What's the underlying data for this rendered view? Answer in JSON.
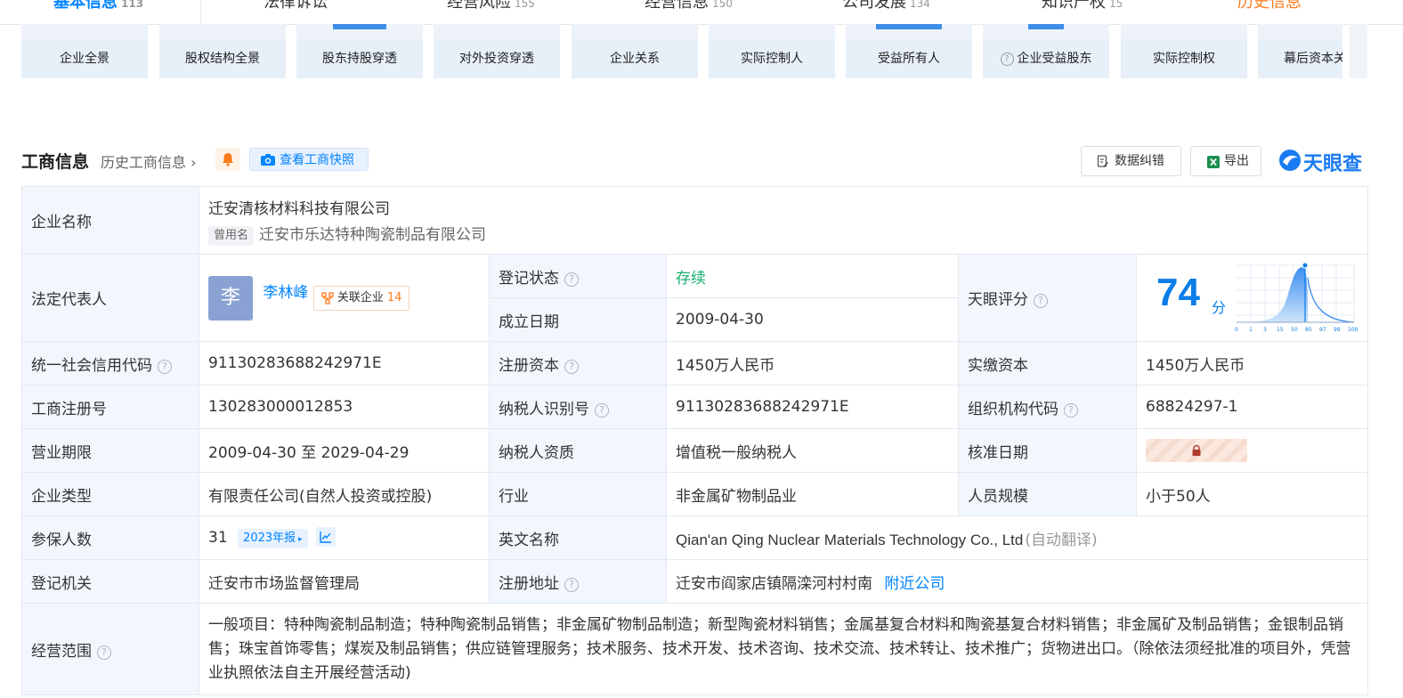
{
  "nav": [
    {
      "label": "基本信息",
      "count": "113",
      "active": true
    },
    {
      "label": "法律诉讼",
      "count": ""
    },
    {
      "label": "经营风险",
      "count": "155"
    },
    {
      "label": "经营信息",
      "count": "150"
    },
    {
      "label": "公司发展",
      "count": "134"
    },
    {
      "label": "知识产权",
      "count": "15"
    },
    {
      "label": "历史信息",
      "count": ""
    }
  ],
  "cards": [
    {
      "label": "企业全景"
    },
    {
      "label": "股权结构全景"
    },
    {
      "label": "股东持股穿透"
    },
    {
      "label": "对外投资穿透"
    },
    {
      "label": "企业关系"
    },
    {
      "label": "实际控制人"
    },
    {
      "label": "受益所有人"
    },
    {
      "label": "企业受益股东"
    },
    {
      "label": "实际控制权"
    },
    {
      "label": "幕后资本关联"
    }
  ],
  "section": {
    "title": "工商信息",
    "history_link": "历史工商信息",
    "snapshot_btn": "查看工商快照",
    "correct_btn": "数据纠错",
    "export_btn": "导出",
    "logo_text": "天眼查"
  },
  "company": {
    "name_label": "企业名称",
    "name": "迁安清核材料科技有限公司",
    "used_name_tag": "曾用名",
    "used_name": "迁安市乐达特种陶瓷制品有限公司",
    "legal_rep_label": "法定代表人",
    "avatar_char": "李",
    "legal_rep": "李林峰",
    "related_label": "关联企业",
    "related_count": "14",
    "reg_status_label": "登记状态",
    "reg_status": "存续",
    "est_date_label": "成立日期",
    "est_date": "2009-04-30",
    "score_label": "天眼评分",
    "score": "74",
    "score_unit": "分",
    "score_ticks": [
      "0",
      "1",
      "3",
      "15",
      "50",
      "85",
      "97",
      "99",
      "100"
    ],
    "credit_code_label": "统一社会信用代码",
    "credit_code": "91130283688242971E",
    "reg_capital_label": "注册资本",
    "reg_capital": "1450万人民币",
    "paid_capital_label": "实缴资本",
    "paid_capital": "1450万人民币",
    "reg_no_label": "工商注册号",
    "reg_no": "130283000012853",
    "taxpayer_id_label": "纳税人识别号",
    "taxpayer_id": "91130283688242971E",
    "org_code_label": "组织机构代码",
    "org_code": "68824297-1",
    "term_label": "营业期限",
    "term": "2009-04-30 至 2029-04-29",
    "taxpayer_qual_label": "纳税人资质",
    "taxpayer_qual": "增值税一般纳税人",
    "approve_date_label": "核准日期",
    "type_label": "企业类型",
    "type": "有限责任公司(自然人投资或控股)",
    "industry_label": "行业",
    "industry": "非金属矿物制品业",
    "staff_label": "人员规模",
    "staff": "小于50人",
    "insured_label": "参保人数",
    "insured": "31",
    "insured_year": "2023年报",
    "english_label": "英文名称",
    "english": "Qian'an Qing Nuclear Materials Technology Co., Ltd",
    "auto_translate": "(自动翻译)",
    "authority_label": "登记机关",
    "authority": "迁安市市场监督管理局",
    "address_label": "注册地址",
    "address": "迁安市阎家店镇隔滦河村村南",
    "nearby": "附近公司",
    "scope_label": "经营范围",
    "scope": "一般项目：特种陶瓷制品制造；特种陶瓷制品销售；非金属矿物制品制造；新型陶瓷材料销售；金属基复合材料和陶瓷基复合材料销售；非金属矿及制品销售；金银制品销售；珠宝首饰零售；煤炭及制品销售；供应链管理服务；技术服务、技术开发、技术咨询、技术交流、技术转让、技术推广；货物进出口。（除依法须经批准的项目外，凭营业执照依法自主开展经营活动)"
  },
  "colors": {
    "accent": "#0084ff",
    "status_green": "#1aae6f",
    "label_bg": "#f2f7fd",
    "orange": "#ff7a1a"
  }
}
